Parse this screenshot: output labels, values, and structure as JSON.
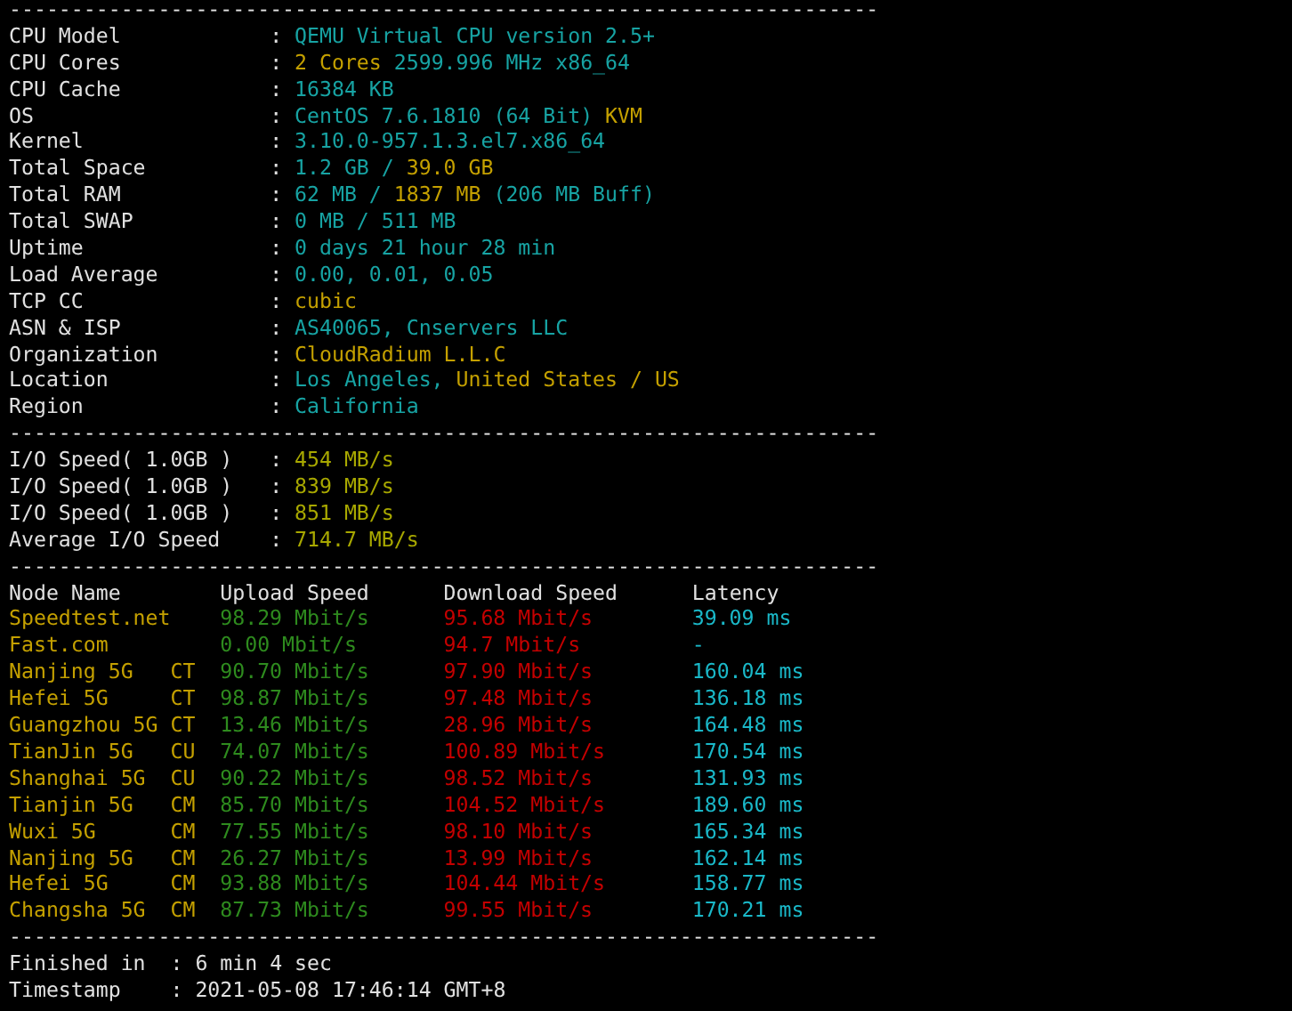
{
  "blocks": [
    {
      "kind": "rule",
      "text": "----------------------------------------------------------------------"
    },
    {
      "kind": "info",
      "rows": [
        {
          "label": "CPU Model",
          "separator": ":",
          "values": [
            {
              "text": "QEMU Virtual CPU version 2.5+",
              "color": "#17a3a3"
            }
          ]
        },
        {
          "label": "CPU Cores",
          "separator": ":",
          "values": [
            {
              "text": "2 Cores",
              "color": "#c4a000"
            },
            {
              "text": "2599.996 MHz x86_64",
              "color": "#17a3a3"
            }
          ]
        },
        {
          "label": "CPU Cache",
          "separator": ":",
          "values": [
            {
              "text": "16384 KB",
              "color": "#17a3a3"
            }
          ]
        },
        {
          "label": "OS",
          "separator": ":",
          "values": [
            {
              "text": "CentOS 7.6.1810 (64 Bit)",
              "color": "#17a3a3"
            },
            {
              "text": "KVM",
              "color": "#c4a000"
            }
          ]
        },
        {
          "label": "Kernel",
          "separator": ":",
          "values": [
            {
              "text": "3.10.0-957.1.3.el7.x86_64",
              "color": "#17a3a3"
            }
          ]
        },
        {
          "label": "Total Space",
          "separator": ":",
          "values": [
            {
              "text": "1.2 GB /",
              "color": "#17a3a3"
            },
            {
              "text": "39.0 GB",
              "color": "#c4a000"
            }
          ]
        },
        {
          "label": "Total RAM",
          "separator": ":",
          "values": [
            {
              "text": "62 MB /",
              "color": "#17a3a3"
            },
            {
              "text": "1837 MB",
              "color": "#c4a000"
            },
            {
              "text": "(206 MB Buff)",
              "color": "#17a3a3"
            }
          ]
        },
        {
          "label": "Total SWAP",
          "separator": ":",
          "values": [
            {
              "text": "0 MB / 511 MB",
              "color": "#17a3a3"
            }
          ]
        },
        {
          "label": "Uptime",
          "separator": ":",
          "values": [
            {
              "text": "0 days 21 hour 28 min",
              "color": "#17a3a3"
            }
          ]
        },
        {
          "label": "Load Average",
          "separator": ":",
          "values": [
            {
              "text": "0.00, 0.01, 0.05",
              "color": "#17a3a3"
            }
          ]
        },
        {
          "label": "TCP CC",
          "separator": ":",
          "values": [
            {
              "text": "cubic",
              "color": "#c4a000"
            }
          ]
        },
        {
          "label": "ASN & ISP",
          "separator": ":",
          "values": [
            {
              "text": "AS40065, Cnservers LLC",
              "color": "#17a3a3"
            }
          ]
        },
        {
          "label": "Organization",
          "separator": ":",
          "values": [
            {
              "text": "CloudRadium L.L.C",
              "color": "#c4a000"
            }
          ]
        },
        {
          "label": "Location",
          "separator": ":",
          "values": [
            {
              "text": "Los Angeles,",
              "color": "#17a3a3"
            },
            {
              "text": "United States / US",
              "color": "#c4a000"
            }
          ]
        },
        {
          "label": "Region",
          "separator": ":",
          "values": [
            {
              "text": "California",
              "color": "#17a3a3"
            }
          ]
        }
      ]
    },
    {
      "kind": "rule",
      "text": "----------------------------------------------------------------------"
    },
    {
      "kind": "info",
      "rows": [
        {
          "label": "I/O Speed( 1.0GB )",
          "separator": ":",
          "values": [
            {
              "text": "454 MB/s",
              "color": "#a8a800"
            }
          ]
        },
        {
          "label": "I/O Speed( 1.0GB )",
          "separator": ":",
          "values": [
            {
              "text": "839 MB/s",
              "color": "#a8a800"
            }
          ]
        },
        {
          "label": "I/O Speed( 1.0GB )",
          "separator": ":",
          "values": [
            {
              "text": "851 MB/s",
              "color": "#a8a800"
            }
          ]
        },
        {
          "label": "Average I/O Speed",
          "separator": ":",
          "values": [
            {
              "text": "714.7 MB/s",
              "color": "#a8a800"
            }
          ]
        }
      ]
    },
    {
      "kind": "rule",
      "text": "----------------------------------------------------------------------"
    },
    {
      "kind": "speed",
      "columns": [
        "Node Name",
        "Upload Speed",
        "Download Speed",
        "Latency"
      ],
      "rows": [
        {
          "node": "Speedtest.net",
          "upload": "98.29 Mbit/s",
          "download": "95.68 Mbit/s",
          "latency": "39.09 ms"
        },
        {
          "node": "Fast.com",
          "upload": "0.00 Mbit/s",
          "download": "94.7 Mbit/s",
          "latency": "-"
        },
        {
          "node": "Nanjing 5G",
          "isp": "CT",
          "upload": "90.70 Mbit/s",
          "download": "97.90 Mbit/s",
          "latency": "160.04 ms"
        },
        {
          "node": "Hefei 5G",
          "isp": "CT",
          "upload": "98.87 Mbit/s",
          "download": "97.48 Mbit/s",
          "latency": "136.18 ms"
        },
        {
          "node": "Guangzhou 5G",
          "isp": "CT",
          "upload": "13.46 Mbit/s",
          "download": "28.96 Mbit/s",
          "latency": "164.48 ms"
        },
        {
          "node": "TianJin 5G",
          "isp": "CU",
          "upload": "74.07 Mbit/s",
          "download": "100.89 Mbit/s",
          "latency": "170.54 ms"
        },
        {
          "node": "Shanghai 5G",
          "isp": "CU",
          "upload": "90.22 Mbit/s",
          "download": "98.52 Mbit/s",
          "latency": "131.93 ms"
        },
        {
          "node": "Tianjin 5G",
          "isp": "CM",
          "upload": "85.70 Mbit/s",
          "download": "104.52 Mbit/s",
          "latency": "189.60 ms"
        },
        {
          "node": "Wuxi 5G",
          "isp": "CM",
          "upload": "77.55 Mbit/s",
          "download": "98.10 Mbit/s",
          "latency": "165.34 ms"
        },
        {
          "node": "Nanjing 5G",
          "isp": "CM",
          "upload": "26.27 Mbit/s",
          "download": "13.99 Mbit/s",
          "latency": "162.14 ms"
        },
        {
          "node": "Hefei 5G",
          "isp": "CM",
          "upload": "93.88 Mbit/s",
          "download": "104.44 Mbit/s",
          "latency": "158.77 ms"
        },
        {
          "node": "Changsha 5G",
          "isp": "CM",
          "upload": "87.73 Mbit/s",
          "download": "99.55 Mbit/s",
          "latency": "170.21 ms"
        }
      ]
    },
    {
      "kind": "rule",
      "text": "----------------------------------------------------------------------"
    },
    {
      "kind": "summary",
      "rows": [
        {
          "label": "Finished in",
          "separator": ":",
          "values": [
            {
              "text": "6 min 4 sec",
              "color": "#e0e0e0"
            }
          ]
        },
        {
          "label": "Timestamp",
          "separator": ":",
          "values": [
            {
              "text": "2021-05-08 17:46:14 GMT+8",
              "color": "#e0e0e0"
            }
          ]
        }
      ]
    }
  ]
}
